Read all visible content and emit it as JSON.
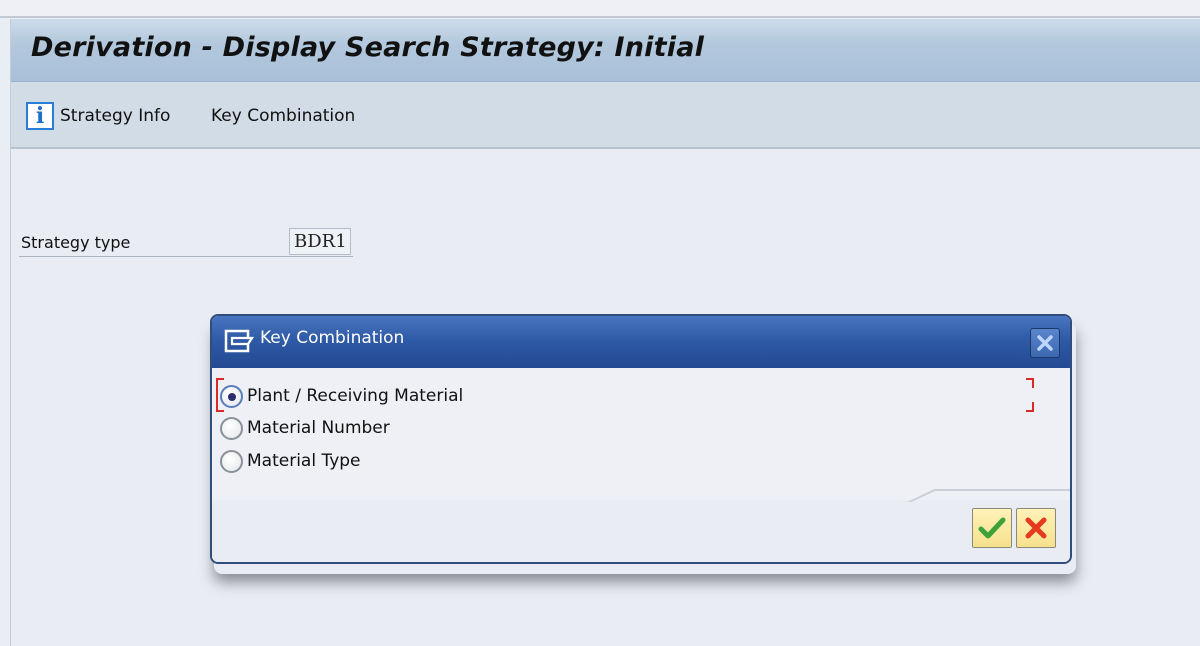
{
  "window": {
    "title": "Derivation - Display Search Strategy: Initial"
  },
  "toolbar": {
    "items": [
      {
        "label": "Strategy Info",
        "icon": "info-icon"
      },
      {
        "label": "Key Combination"
      }
    ]
  },
  "form": {
    "strategy_type_label": "Strategy type",
    "strategy_type_value": "BDR1"
  },
  "dialog": {
    "title": "Key Combination",
    "options": [
      {
        "label": "Plant / Receiving Material",
        "selected": true
      },
      {
        "label": "Material Number",
        "selected": false
      },
      {
        "label": "Material Type",
        "selected": false
      }
    ],
    "confirm_icon": "checkmark-icon",
    "cancel_icon": "cancel-x-icon"
  },
  "colors": {
    "dialog_header": "#2f5aa6",
    "focus_bracket": "#d92a2a",
    "confirm_green": "#3ea23a",
    "cancel_red": "#e53a1e"
  }
}
